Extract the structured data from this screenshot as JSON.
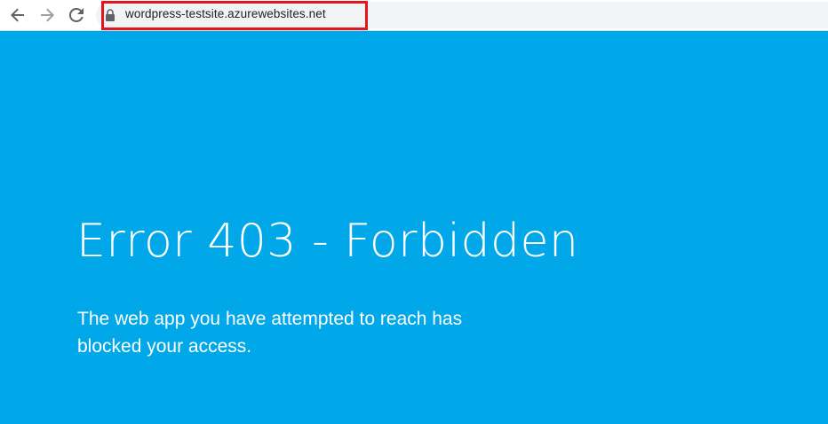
{
  "browser": {
    "address_bar": {
      "url": "wordpress-testsite.azurewebsites.net",
      "lock_icon": "lock-icon",
      "highlight_color": "#e3161f"
    },
    "nav": {
      "back_icon": "arrow-left-icon",
      "forward_icon": "arrow-right-icon",
      "reload_icon": "reload-icon"
    }
  },
  "page": {
    "background_color": "#00a8ea",
    "title": "Error 403 - Forbidden",
    "message": "The web app you have attempted to reach has blocked your access."
  }
}
